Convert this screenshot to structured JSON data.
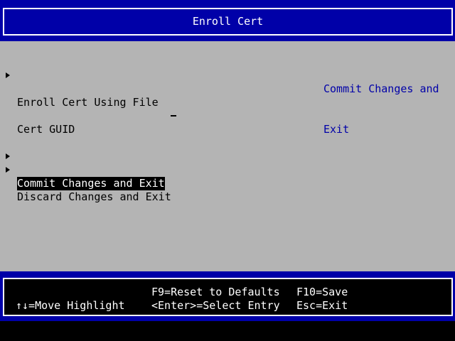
{
  "title": "Enroll Cert",
  "menu": {
    "enroll_using_file": "Enroll Cert Using File",
    "cert_guid_label": "Cert GUID",
    "commit": "Commit Changes and Exit",
    "discard": "Discard Changes and Exit"
  },
  "help": {
    "line1": "Commit Changes and",
    "line2": "Exit"
  },
  "footer": {
    "move_highlight": "↑↓=Move Highlight",
    "reset_defaults": "F9=Reset to Defaults",
    "select_entry": "<Enter>=Select Entry",
    "save": "F10=Save",
    "exit": "Esc=Exit"
  },
  "colors": {
    "header_blue": "#0000a8",
    "body_gray": "#b4b4b4",
    "help_text_blue": "#0000a8",
    "highlight_bg": "#000000",
    "highlight_fg": "#ffffff"
  }
}
